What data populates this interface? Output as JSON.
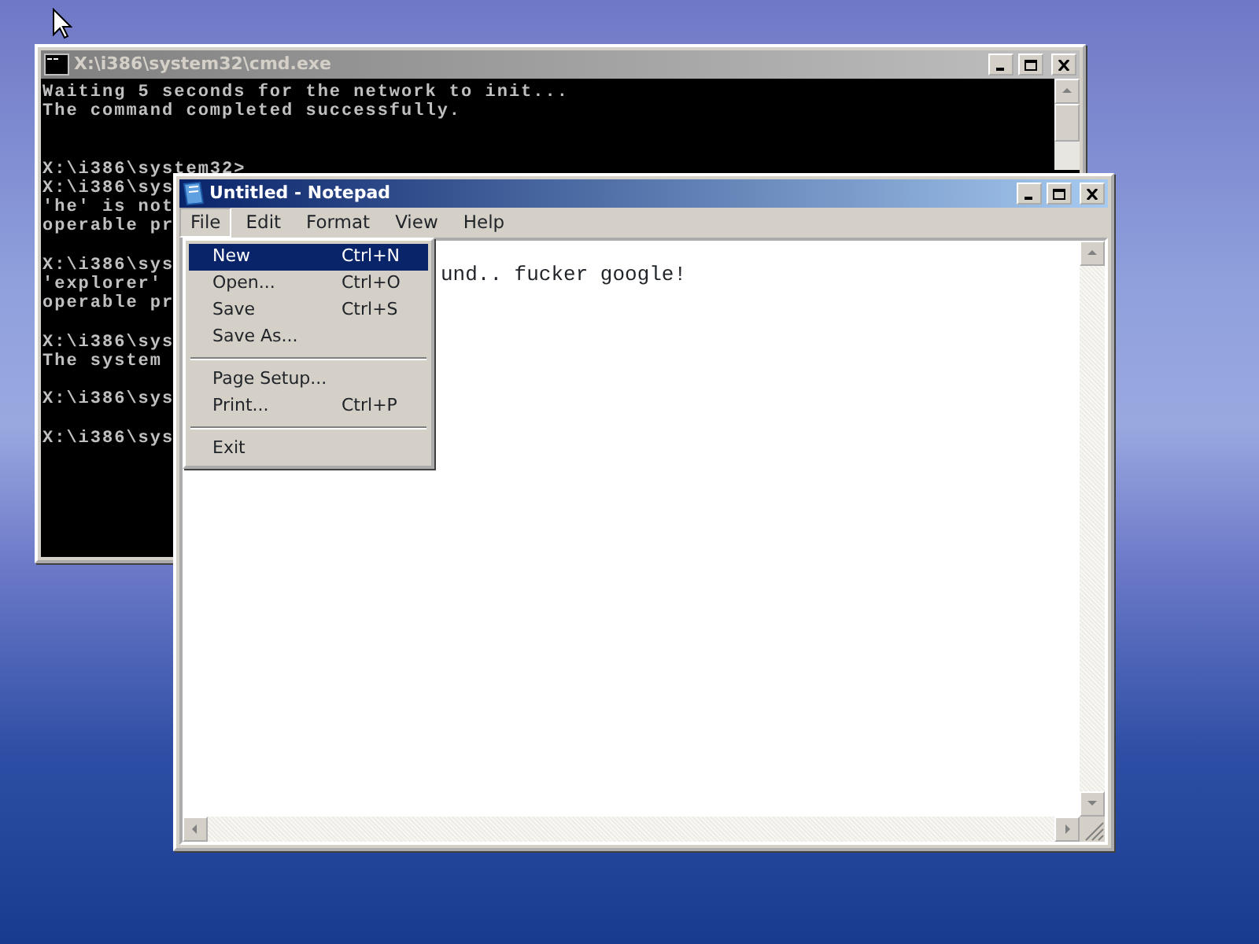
{
  "cmd_window": {
    "title": "X:\\i386\\system32\\cmd.exe",
    "active": false,
    "output": [
      "Waiting 5 seconds for the network to init...",
      "The command completed successfully."
    ],
    "sessions": [
      [
        "X:\\i386\\system32>",
        "X:\\i386\\sys",
        "'he' is not",
        "operable pr"
      ],
      [
        "X:\\i386\\sys",
        "'explorer'",
        "operable pr"
      ],
      [
        "X:\\i386\\sys",
        "The system"
      ],
      [
        "X:\\i386\\sys"
      ],
      [
        "X:\\i386\\sys"
      ]
    ]
  },
  "notepad": {
    "title": "Untitled - Notepad",
    "active": true,
    "menu": [
      {
        "label": "File",
        "selected": true
      },
      {
        "label": "Edit",
        "selected": false
      },
      {
        "label": "Format",
        "selected": false
      },
      {
        "label": "View",
        "selected": false
      },
      {
        "label": "Help",
        "selected": false
      }
    ],
    "text": "und.. fucker google!"
  },
  "file_menu": [
    {
      "kind": "item",
      "label": "New",
      "shortcut": "Ctrl+N",
      "selected": true
    },
    {
      "kind": "item",
      "label": "Open...",
      "shortcut": "Ctrl+O",
      "selected": false
    },
    {
      "kind": "item",
      "label": "Save",
      "shortcut": "Ctrl+S",
      "selected": false
    },
    {
      "kind": "item",
      "label": "Save As...",
      "selected": false
    },
    {
      "kind": "separator"
    },
    {
      "kind": "item",
      "label": "Page Setup...",
      "selected": false
    },
    {
      "kind": "item",
      "label": "Print...",
      "shortcut": "Ctrl+P",
      "selected": false
    },
    {
      "kind": "separator"
    },
    {
      "kind": "item",
      "label": "Exit",
      "selected": false
    }
  ]
}
